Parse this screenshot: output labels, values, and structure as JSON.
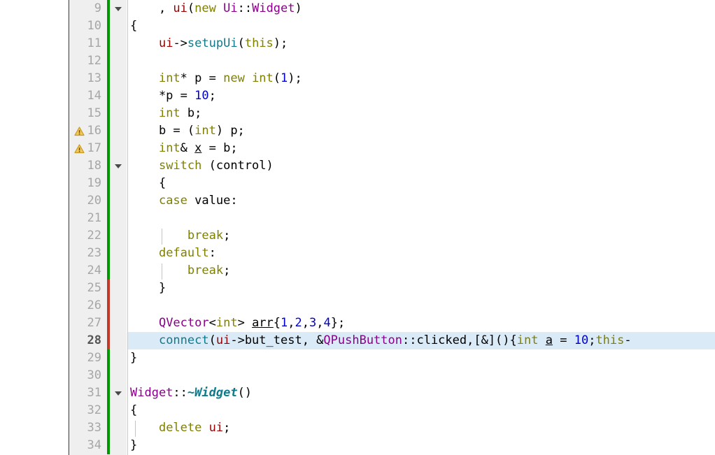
{
  "editor": {
    "language": "C++",
    "first_visible_line": 9,
    "last_visible_line": 34,
    "current_line": 28,
    "line_height_px": 25,
    "colors": {
      "background": "#ffffff",
      "gutter_background": "#efefef",
      "line_number": "#a6a6a6",
      "current_line_number": "#555555",
      "current_line_highlight": "#daeaf7",
      "changebar_added": "#009900",
      "changebar_changed": "#c0392b",
      "keyword": "#808000",
      "number": "#0000cc",
      "class_name": "#8b008b",
      "member_variable": "#990000",
      "function": "#0e7b8c",
      "indent_guide": "#c4c4c4",
      "warning_icon": "#e0a81c"
    },
    "gutter": {
      "warning_icon_name": "warning-triangle-icon",
      "fold_icon_name": "chevron-down-icon",
      "warning_lines": [
        16,
        17
      ],
      "fold_lines": [
        9,
        18,
        31
      ],
      "changebar_added_ranges": [
        [
          9,
          24
        ],
        [
          29,
          34
        ]
      ],
      "changebar_changed_ranges": [
        [
          25,
          28
        ]
      ]
    },
    "lines": [
      {
        "number": 9,
        "indent_guides": [],
        "tokens": [
          {
            "text": "    , ",
            "cls": "t-plain"
          },
          {
            "text": "ui",
            "cls": "t-member"
          },
          {
            "text": "(",
            "cls": "t-plain"
          },
          {
            "text": "new",
            "cls": "t-kw"
          },
          {
            "text": " ",
            "cls": "t-plain"
          },
          {
            "text": "Ui",
            "cls": "t-class"
          },
          {
            "text": "::",
            "cls": "t-plain"
          },
          {
            "text": "Widget",
            "cls": "t-class"
          },
          {
            "text": ")",
            "cls": "t-plain"
          }
        ]
      },
      {
        "number": 10,
        "indent_guides": [],
        "tokens": [
          {
            "text": "{",
            "cls": "t-plain"
          }
        ]
      },
      {
        "number": 11,
        "indent_guides": [],
        "tokens": [
          {
            "text": "    ",
            "cls": "t-plain"
          },
          {
            "text": "ui",
            "cls": "t-member"
          },
          {
            "text": "->",
            "cls": "t-plain"
          },
          {
            "text": "setupUi",
            "cls": "t-func"
          },
          {
            "text": "(",
            "cls": "t-plain"
          },
          {
            "text": "this",
            "cls": "t-kw"
          },
          {
            "text": ");",
            "cls": "t-plain"
          }
        ]
      },
      {
        "number": 12,
        "indent_guides": [],
        "tokens": []
      },
      {
        "number": 13,
        "indent_guides": [],
        "tokens": [
          {
            "text": "    ",
            "cls": "t-plain"
          },
          {
            "text": "int",
            "cls": "t-type"
          },
          {
            "text": "* p = ",
            "cls": "t-plain"
          },
          {
            "text": "new",
            "cls": "t-kw"
          },
          {
            "text": " ",
            "cls": "t-plain"
          },
          {
            "text": "int",
            "cls": "t-type"
          },
          {
            "text": "(",
            "cls": "t-plain"
          },
          {
            "text": "1",
            "cls": "t-num"
          },
          {
            "text": ");",
            "cls": "t-plain"
          }
        ]
      },
      {
        "number": 14,
        "indent_guides": [],
        "tokens": [
          {
            "text": "    *p = ",
            "cls": "t-plain"
          },
          {
            "text": "10",
            "cls": "t-num"
          },
          {
            "text": ";",
            "cls": "t-plain"
          }
        ]
      },
      {
        "number": 15,
        "indent_guides": [],
        "tokens": [
          {
            "text": "    ",
            "cls": "t-plain"
          },
          {
            "text": "int",
            "cls": "t-type"
          },
          {
            "text": " b;",
            "cls": "t-plain"
          }
        ]
      },
      {
        "number": 16,
        "indent_guides": [],
        "tokens": [
          {
            "text": "    b = (",
            "cls": "t-plain"
          },
          {
            "text": "int",
            "cls": "t-type"
          },
          {
            "text": ") p;",
            "cls": "t-plain"
          }
        ]
      },
      {
        "number": 17,
        "indent_guides": [],
        "tokens": [
          {
            "text": "    ",
            "cls": "t-plain"
          },
          {
            "text": "int",
            "cls": "t-type"
          },
          {
            "text": "& ",
            "cls": "t-plain"
          },
          {
            "text": "x",
            "cls": "t-var-und"
          },
          {
            "text": " = b;",
            "cls": "t-plain"
          }
        ]
      },
      {
        "number": 18,
        "indent_guides": [],
        "tokens": [
          {
            "text": "    ",
            "cls": "t-plain"
          },
          {
            "text": "switch",
            "cls": "t-kw"
          },
          {
            "text": " (control)",
            "cls": "t-plain"
          }
        ]
      },
      {
        "number": 19,
        "indent_guides": [],
        "tokens": [
          {
            "text": "    {",
            "cls": "t-plain"
          }
        ]
      },
      {
        "number": 20,
        "indent_guides": [],
        "tokens": [
          {
            "text": "    ",
            "cls": "t-plain"
          },
          {
            "text": "case",
            "cls": "t-kw"
          },
          {
            "text": " value:",
            "cls": "t-plain"
          }
        ]
      },
      {
        "number": 21,
        "indent_guides": [],
        "tokens": []
      },
      {
        "number": 22,
        "indent_guides": [
          48
        ],
        "tokens": [
          {
            "text": "        ",
            "cls": "t-plain"
          },
          {
            "text": "break",
            "cls": "t-kw"
          },
          {
            "text": ";",
            "cls": "t-plain"
          }
        ]
      },
      {
        "number": 23,
        "indent_guides": [],
        "tokens": [
          {
            "text": "    ",
            "cls": "t-plain"
          },
          {
            "text": "default",
            "cls": "t-kw"
          },
          {
            "text": ":",
            "cls": "t-plain"
          }
        ]
      },
      {
        "number": 24,
        "indent_guides": [
          48
        ],
        "tokens": [
          {
            "text": "        ",
            "cls": "t-plain"
          },
          {
            "text": "break",
            "cls": "t-kw"
          },
          {
            "text": ";",
            "cls": "t-plain"
          }
        ]
      },
      {
        "number": 25,
        "indent_guides": [],
        "tokens": [
          {
            "text": "    }",
            "cls": "t-plain"
          }
        ]
      },
      {
        "number": 26,
        "indent_guides": [],
        "tokens": []
      },
      {
        "number": 27,
        "indent_guides": [],
        "tokens": [
          {
            "text": "    ",
            "cls": "t-plain"
          },
          {
            "text": "QVector",
            "cls": "t-class"
          },
          {
            "text": "<",
            "cls": "t-plain"
          },
          {
            "text": "int",
            "cls": "t-type"
          },
          {
            "text": "> ",
            "cls": "t-plain"
          },
          {
            "text": "arr",
            "cls": "t-var-und"
          },
          {
            "text": "{",
            "cls": "t-plain"
          },
          {
            "text": "1",
            "cls": "t-num"
          },
          {
            "text": ",",
            "cls": "t-plain"
          },
          {
            "text": "2",
            "cls": "t-num"
          },
          {
            "text": ",",
            "cls": "t-plain"
          },
          {
            "text": "3",
            "cls": "t-num"
          },
          {
            "text": ",",
            "cls": "t-plain"
          },
          {
            "text": "4",
            "cls": "t-num"
          },
          {
            "text": "};",
            "cls": "t-plain"
          }
        ]
      },
      {
        "number": 28,
        "indent_guides": [],
        "tokens": [
          {
            "text": "    ",
            "cls": "t-plain"
          },
          {
            "text": "connect",
            "cls": "t-func"
          },
          {
            "text": "(",
            "cls": "t-plain"
          },
          {
            "text": "ui",
            "cls": "t-member"
          },
          {
            "text": "->but_test, &",
            "cls": "t-plain"
          },
          {
            "text": "QPushButton",
            "cls": "t-class"
          },
          {
            "text": "::clicked,[&](){",
            "cls": "t-plain"
          },
          {
            "text": "int",
            "cls": "t-type"
          },
          {
            "text": " ",
            "cls": "t-plain"
          },
          {
            "text": "a",
            "cls": "t-var-und"
          },
          {
            "text": " = ",
            "cls": "t-plain"
          },
          {
            "text": "10",
            "cls": "t-num"
          },
          {
            "text": ";",
            "cls": "t-plain"
          },
          {
            "text": "this",
            "cls": "t-kw"
          },
          {
            "text": "-",
            "cls": "t-plain"
          }
        ]
      },
      {
        "number": 29,
        "indent_guides": [],
        "tokens": [
          {
            "text": "}",
            "cls": "t-plain"
          }
        ]
      },
      {
        "number": 30,
        "indent_guides": [],
        "tokens": []
      },
      {
        "number": 31,
        "indent_guides": [],
        "tokens": [
          {
            "text": "Widget",
            "cls": "t-class"
          },
          {
            "text": "::",
            "cls": "t-plain"
          },
          {
            "text": "~Widget",
            "cls": "t-dtor"
          },
          {
            "text": "()",
            "cls": "t-plain"
          }
        ]
      },
      {
        "number": 32,
        "indent_guides": [],
        "tokens": [
          {
            "text": "{",
            "cls": "t-plain"
          }
        ]
      },
      {
        "number": 33,
        "indent_guides": [
          10
        ],
        "tokens": [
          {
            "text": "    ",
            "cls": "t-plain"
          },
          {
            "text": "delete",
            "cls": "t-kw"
          },
          {
            "text": " ",
            "cls": "t-plain"
          },
          {
            "text": "ui",
            "cls": "t-member"
          },
          {
            "text": ";",
            "cls": "t-plain"
          }
        ]
      },
      {
        "number": 34,
        "indent_guides": [],
        "tokens": [
          {
            "text": "}",
            "cls": "t-plain"
          }
        ]
      }
    ]
  }
}
